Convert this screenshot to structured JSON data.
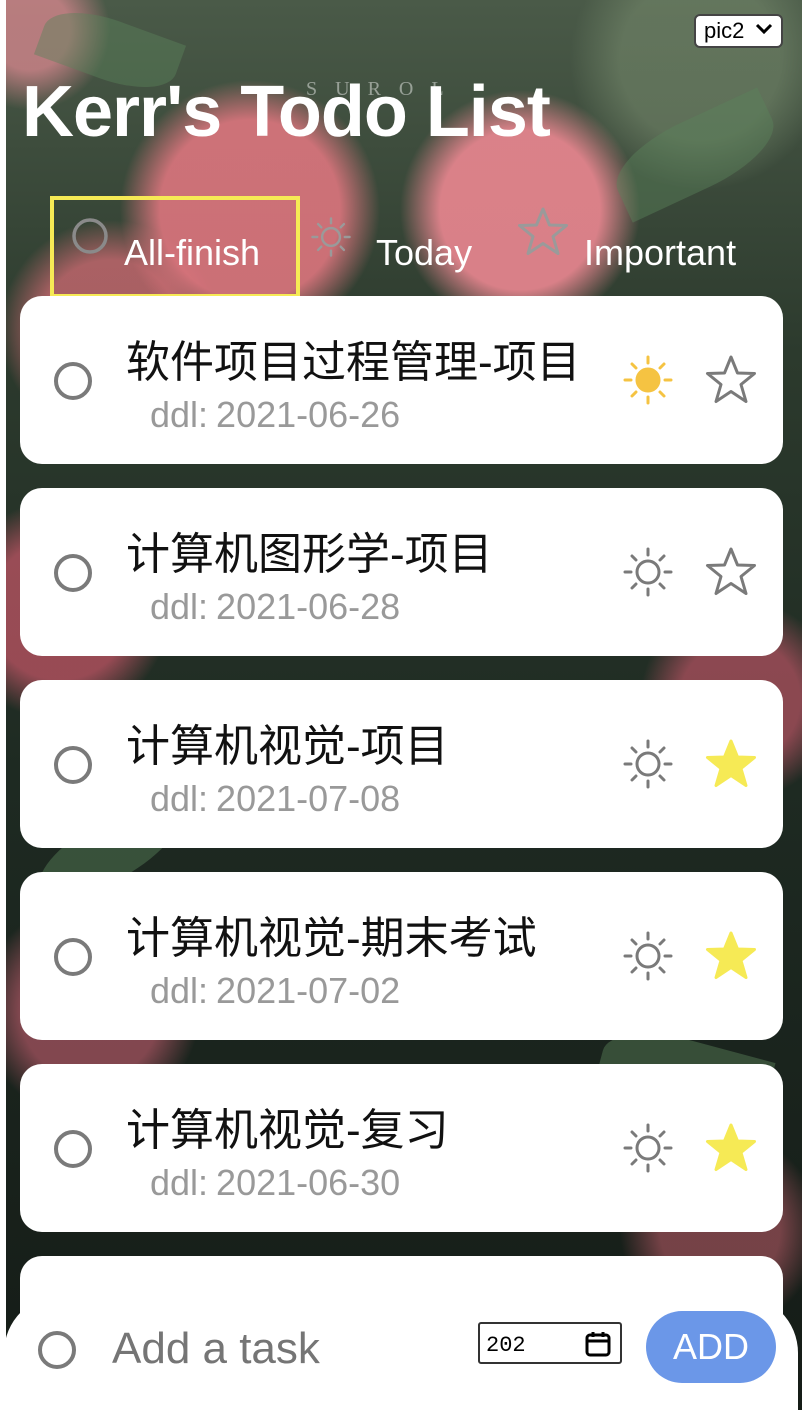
{
  "app": {
    "title": "Kerr's Todo List",
    "background_brand": "SUROL",
    "background_select": {
      "value": "pic2"
    }
  },
  "filters": [
    {
      "label": "All-finish",
      "icon": "circle-icon",
      "active": true
    },
    {
      "label": "Today",
      "icon": "sun-icon",
      "active": false
    },
    {
      "label": "Important",
      "icon": "star-icon",
      "active": false
    }
  ],
  "tasks": [
    {
      "name": "软件项目过程管理-项目",
      "ddl_label": "ddl:",
      "ddl": "2021-06-26",
      "today": true,
      "important": false
    },
    {
      "name": "计算机图形学-项目",
      "ddl_label": "ddl:",
      "ddl": "2021-06-28",
      "today": false,
      "important": false
    },
    {
      "name": "计算机视觉-项目",
      "ddl_label": "ddl:",
      "ddl": "2021-07-08",
      "today": false,
      "important": true
    },
    {
      "name": "计算机视觉-期末考试",
      "ddl_label": "ddl:",
      "ddl": "2021-07-02",
      "today": false,
      "important": true
    },
    {
      "name": "计算机视觉-复习",
      "ddl_label": "ddl:",
      "ddl": "2021-06-30",
      "today": false,
      "important": true
    }
  ],
  "add_task": {
    "placeholder": "Add a task",
    "date_value": "202",
    "button_label": "ADD"
  },
  "colors": {
    "accent_blue": "#6b97e8",
    "active_filter_border": "#f6ea55",
    "sun_active": "#f5c342",
    "star_active": "#f6ea55",
    "icon_inactive": "#7a7a7a",
    "ddl_text": "#999999"
  }
}
